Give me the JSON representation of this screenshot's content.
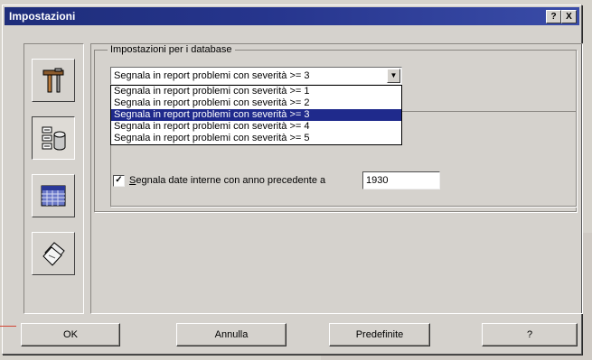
{
  "window": {
    "title": "Impostazioni",
    "help_glyph": "?",
    "close_glyph": "X"
  },
  "sidebar": {
    "items": [
      {
        "icon": "tools-icon"
      },
      {
        "icon": "database-icon"
      },
      {
        "icon": "calendar-icon"
      },
      {
        "icon": "report-pages-icon"
      }
    ],
    "selected_index": 1
  },
  "group": {
    "label": "Impostazioni per i database",
    "severity_select": {
      "value": "Segnala in report problemi con severità >= 3",
      "options": [
        "Segnala in report problemi con severità >= 1",
        "Segnala in report problemi con severità >= 2",
        "Segnala in report problemi con severità >= 3",
        "Segnala in report problemi con severità >= 4",
        "Segnala in report problemi con severità >= 5"
      ],
      "highlighted_index": 2
    },
    "date_check": {
      "checked": true,
      "mark": "✓",
      "label_first": "S",
      "label_rest": "egnala date interne con anno precedente a",
      "year_value": "1930"
    }
  },
  "buttons": {
    "ok": "OK",
    "cancel": "Annulla",
    "defaults": "Predefinite",
    "help": "?"
  },
  "colors": {
    "titlebar": "#1e2d7a",
    "selection": "#1f2a8c",
    "face": "#d5d2cd"
  }
}
